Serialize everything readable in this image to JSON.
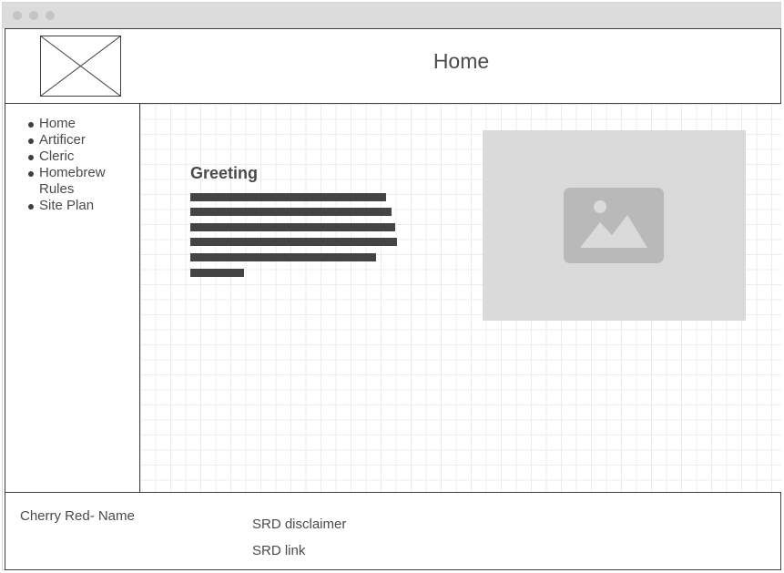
{
  "header": {
    "title": "Home",
    "logo_icon": "image-placeholder-icon"
  },
  "sidebar": {
    "items": [
      {
        "label": "Home"
      },
      {
        "label": "Artificer"
      },
      {
        "label": "Cleric"
      },
      {
        "label": "Homebrew Rules"
      },
      {
        "label": "Site Plan"
      }
    ]
  },
  "main": {
    "greeting": "Greeting",
    "greeting_text_lines": 6,
    "image_icon": "image-icon"
  },
  "footer": {
    "owner": "Cherry Red- Name",
    "srd_disclaimer": "SRD disclaimer",
    "srd_link": "SRD link"
  },
  "colors": {
    "frame_border": "#3e3e3e",
    "text": "#4a4a4a",
    "text_bar": "#444444",
    "image_placeholder": "#dadada",
    "image_glyph": "#b9b9b9",
    "titlebar": "#dcdcdc"
  }
}
